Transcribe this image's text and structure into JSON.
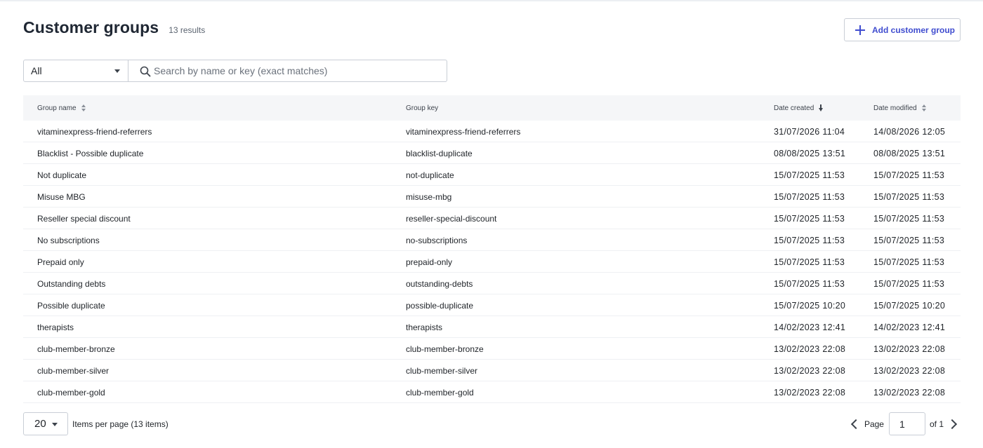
{
  "header": {
    "title": "Customer groups",
    "result_count": "13 results",
    "add_button_label": "Add customer group"
  },
  "filters": {
    "select_value": "All",
    "search_placeholder": "Search by name or key (exact matches)"
  },
  "table": {
    "columns": [
      {
        "label": "Group name",
        "sort": "unsorted"
      },
      {
        "label": "Group key",
        "sort": "none"
      },
      {
        "label": "Date created",
        "sort": "descending"
      },
      {
        "label": "Date modified",
        "sort": "unsorted"
      }
    ],
    "rows": [
      {
        "name": "vitaminexpress-friend-referrers",
        "key": "vitaminexpress-friend-referrers",
        "created": "31/07/2026 11:04",
        "modified": "14/08/2026 12:05"
      },
      {
        "name": "Blacklist - Possible duplicate",
        "key": "blacklist-duplicate",
        "created": "08/08/2025 13:51",
        "modified": "08/08/2025 13:51"
      },
      {
        "name": "Not duplicate",
        "key": "not-duplicate",
        "created": "15/07/2025 11:53",
        "modified": "15/07/2025 11:53"
      },
      {
        "name": "Misuse MBG",
        "key": "misuse-mbg",
        "created": "15/07/2025 11:53",
        "modified": "15/07/2025 11:53"
      },
      {
        "name": "Reseller special discount",
        "key": "reseller-special-discount",
        "created": "15/07/2025 11:53",
        "modified": "15/07/2025 11:53"
      },
      {
        "name": "No subscriptions",
        "key": "no-subscriptions",
        "created": "15/07/2025 11:53",
        "modified": "15/07/2025 11:53"
      },
      {
        "name": "Prepaid only",
        "key": "prepaid-only",
        "created": "15/07/2025 11:53",
        "modified": "15/07/2025 11:53"
      },
      {
        "name": "Outstanding debts",
        "key": "outstanding-debts",
        "created": "15/07/2025 11:53",
        "modified": "15/07/2025 11:53"
      },
      {
        "name": "Possible duplicate",
        "key": "possible-duplicate",
        "created": "15/07/2025 10:20",
        "modified": "15/07/2025 10:20"
      },
      {
        "name": "therapists",
        "key": "therapists",
        "created": "14/02/2023 12:41",
        "modified": "14/02/2023 12:41"
      },
      {
        "name": "club-member-bronze",
        "key": "club-member-bronze",
        "created": "13/02/2023 22:08",
        "modified": "13/02/2023 22:08"
      },
      {
        "name": "club-member-silver",
        "key": "club-member-silver",
        "created": "13/02/2023 22:08",
        "modified": "13/02/2023 22:08"
      },
      {
        "name": "club-member-gold",
        "key": "club-member-gold",
        "created": "13/02/2023 22:08",
        "modified": "13/02/2023 22:08"
      }
    ]
  },
  "footer": {
    "per_page_value": "20",
    "per_page_label": "Items per page (13 items)",
    "page_label": "Page",
    "current_page": "1",
    "of_label": "of 1"
  },
  "colors": {
    "accent": "#3f4ccf",
    "header_bg": "#f5f6f8",
    "border": "#c9ced6"
  },
  "icons": {
    "add": "plus-icon",
    "search": "search-icon",
    "prev": "chevron-left-icon",
    "next": "chevron-right-icon"
  }
}
